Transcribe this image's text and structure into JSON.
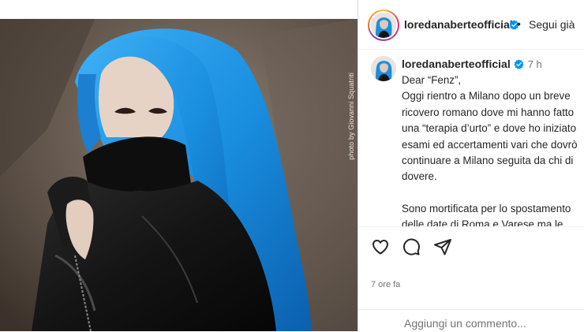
{
  "post": {
    "photo_credit": "photo by Giovanni Squatriti"
  },
  "header": {
    "username": "loredanaberteofficial",
    "separator": "•",
    "follow_label": "Segui già"
  },
  "caption": {
    "username": "loredanaberteofficial",
    "time": "7 h",
    "lines": [
      "Dear “Fenz”,",
      "Oggi rientro a Milano dopo un breve ricovero romano dove mi hanno fatto una “terapia d’urto” e dove ho iniziato esami ed accertamenti vari che dovrò continuare a Milano seguita da chi di dovere.",
      "Sono mortificata per lo spostamento delle date di Roma e Varese ma le mie condizioni fisiche non mi hanno"
    ]
  },
  "actions": {
    "like": "heart-icon",
    "comment": "comment-icon",
    "share": "share-icon"
  },
  "footer": {
    "timestamp": "7 ore fa",
    "comment_placeholder": "Aggiungi un commento..."
  },
  "colors": {
    "hair": "#1a8fe0",
    "verified": "#0095f6",
    "text": "#262626",
    "secondary": "#737373"
  }
}
